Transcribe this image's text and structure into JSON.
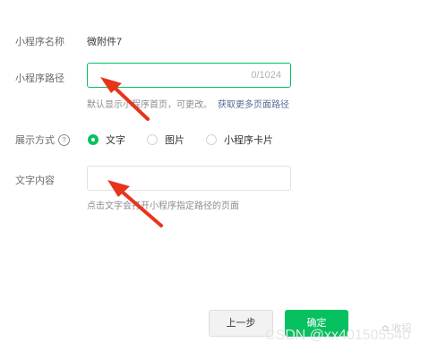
{
  "form": {
    "name": {
      "label": "小程序名称",
      "value": "微附件7"
    },
    "path": {
      "label": "小程序路径",
      "value": "",
      "counter": "0/1024",
      "hint": "默认显示小程序首页，可更改。",
      "link": "获取更多页面路径"
    },
    "display": {
      "label": "展示方式",
      "help_icon": "question-circle-icon",
      "options": [
        "文字",
        "图片",
        "小程序卡片"
      ],
      "selected": "文字"
    },
    "text": {
      "label": "文字内容",
      "value": "",
      "hint": "点击文字会打开小程序指定路径的页面"
    }
  },
  "buttons": {
    "prev": "上一步",
    "confirm": "确定"
  },
  "watermark": {
    "csdn": "CSDN @xx401505540",
    "wechat_label": "收招"
  },
  "annotation": {
    "arrow_color": "#e8341c"
  },
  "colors": {
    "accent": "#07c160",
    "link": "#576b95"
  }
}
